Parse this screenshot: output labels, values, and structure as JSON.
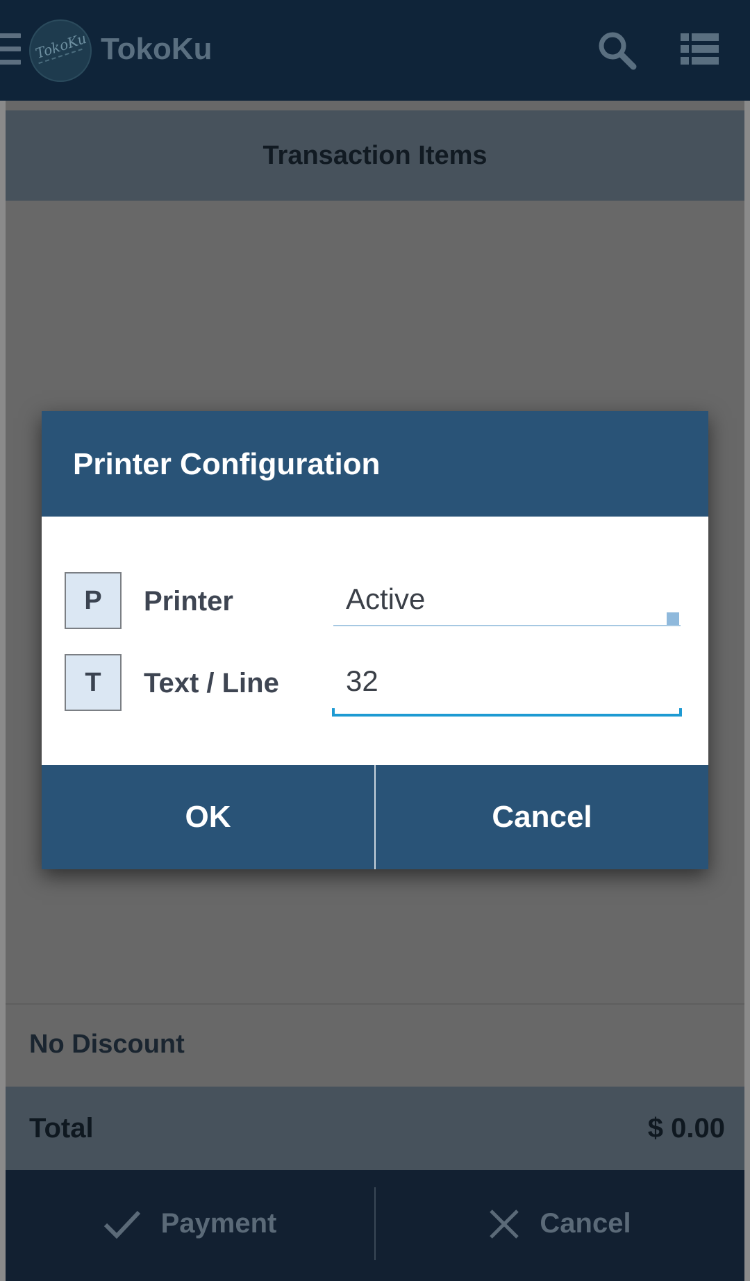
{
  "appbar": {
    "title": "TokoKu",
    "logo_text": "TokoKu",
    "icons": [
      "menu-icon",
      "search-icon",
      "list-view-icon"
    ]
  },
  "items": {
    "header": "Transaction Items"
  },
  "summary": {
    "discount": "No Discount",
    "total_label": "Total",
    "total_value": "$ 0.00"
  },
  "bottom_bar": {
    "payment_label": "Payment",
    "cancel_label": "Cancel"
  },
  "dialog": {
    "title": "Printer Configuration",
    "printer": {
      "badge": "P",
      "label": "Printer",
      "value": "Active"
    },
    "text_line": {
      "badge": "T",
      "label": "Text / Line",
      "value": "32"
    },
    "ok_label": "OK",
    "cancel_label": "Cancel"
  },
  "colors": {
    "appbar": "#0f2439",
    "dialog_header": "#295377",
    "accent_underline": "#1e9ad2",
    "overlay": "#686868"
  }
}
